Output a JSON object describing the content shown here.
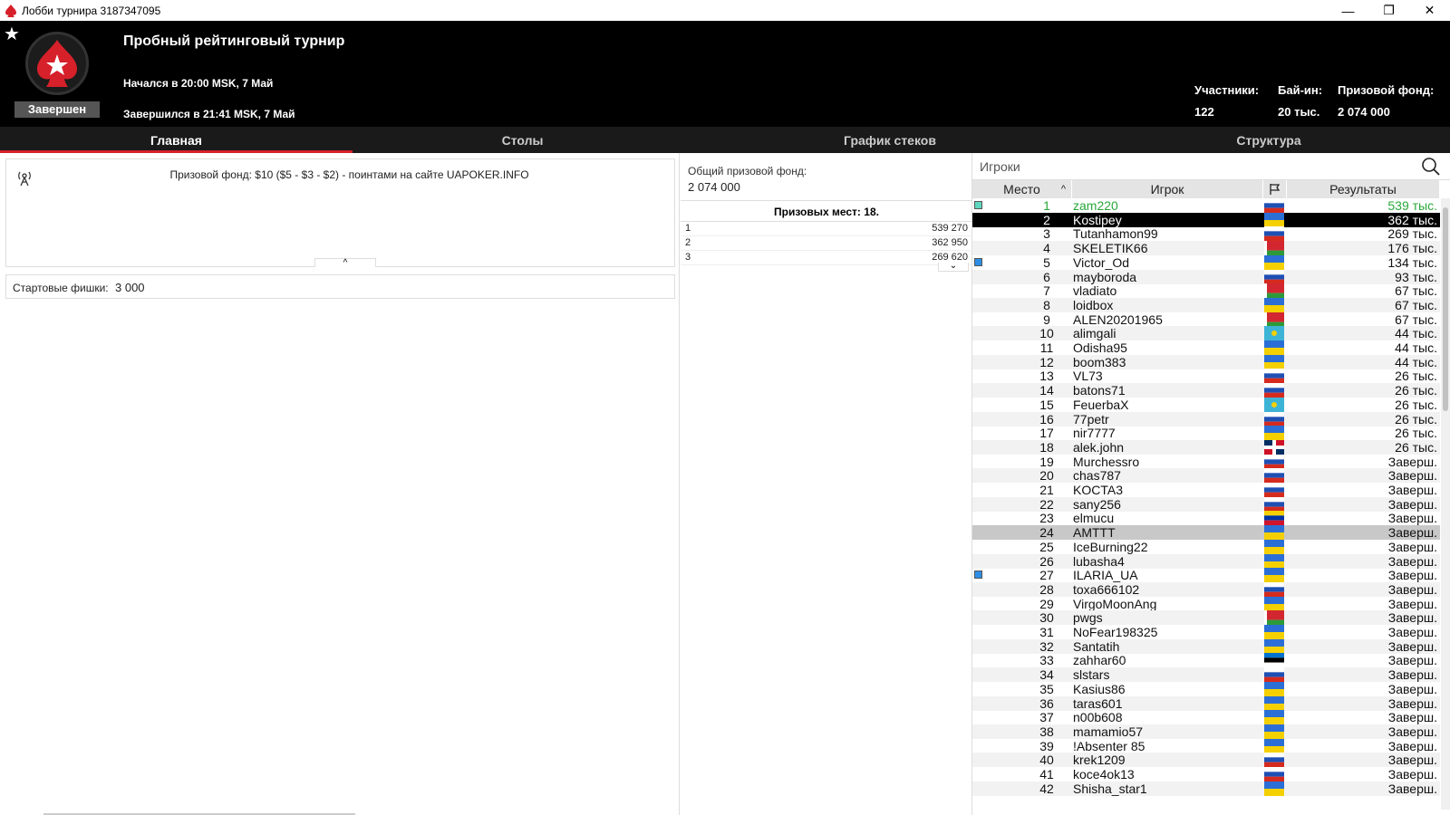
{
  "window": {
    "title": "Лобби турнира 3187347095",
    "minimize": "—",
    "maximize": "❐",
    "close": "✕"
  },
  "header": {
    "status": "Завершен",
    "name": "Пробный рейтинговый турнир",
    "started": "Начался в 20:00 MSK, 7 Май",
    "ended": "Завершился в 21:41 MSK, 7 Май",
    "participants_label": "Участники:",
    "participants_value": "122",
    "buyin_label": "Бай-ин:",
    "buyin_value": "20 тыс.",
    "prizepool_label": "Призовой фонд:",
    "prizepool_value": "2 074 000"
  },
  "tabs": [
    "Главная",
    "Столы",
    "График стеков",
    "Структура"
  ],
  "main": {
    "info_text": "Призовой фонд: $10 ($5 - $3 - $2) - поинтами на сайте UAPOKER.INFO",
    "collapse_glyph": "^",
    "chips_label": "Стартовые фишки:",
    "chips_value": "3 000"
  },
  "prizes": {
    "pool_label": "Общий призовой фонд:",
    "pool_value": "2 074 000",
    "places_label": "Призовых мест: 18.",
    "expand_glyph": "⌄",
    "rows": [
      {
        "place": "1",
        "amount": "539 270"
      },
      {
        "place": "2",
        "amount": "362 950"
      },
      {
        "place": "3",
        "amount": "269 620"
      }
    ]
  },
  "players": {
    "search_placeholder": "Игроки",
    "col_place": "Место",
    "col_player": "Игрок",
    "col_results": "Результаты",
    "colors": {
      "accent": "#d6202a",
      "win": "#2aa83a",
      "mark_teal": "#5fd6c0",
      "mark_blue": "#2d8ee6"
    },
    "rows": [
      {
        "place": "1",
        "nick": "zam220",
        "flag": "ru",
        "result": "539 тыс.",
        "mark": "teal"
      },
      {
        "place": "2",
        "nick": "Kostipey",
        "flag": "ua",
        "result": "362 тыс."
      },
      {
        "place": "3",
        "nick": "Tutanhamon99",
        "flag": "ru",
        "result": "269 тыс."
      },
      {
        "place": "4",
        "nick": "SKELETIK66",
        "flag": "by",
        "result": "176 тыс."
      },
      {
        "place": "5",
        "nick": "Victor_Od",
        "flag": "ua",
        "result": "134 тыс.",
        "mark": "blue"
      },
      {
        "place": "6",
        "nick": "mayboroda",
        "flag": "ru",
        "result": "93 тыс."
      },
      {
        "place": "7",
        "nick": "vladiato",
        "flag": "by",
        "result": "67 тыс."
      },
      {
        "place": "8",
        "nick": "loidbox",
        "flag": "ua",
        "result": "67 тыс."
      },
      {
        "place": "9",
        "nick": "ALEN20201965",
        "flag": "by",
        "result": "67 тыс."
      },
      {
        "place": "10",
        "nick": "alimgali",
        "flag": "kz",
        "result": "44 тыс."
      },
      {
        "place": "11",
        "nick": "Odisha95",
        "flag": "ua",
        "result": "44 тыс."
      },
      {
        "place": "12",
        "nick": "boom383",
        "flag": "ua",
        "result": "44 тыс."
      },
      {
        "place": "13",
        "nick": "VL73",
        "flag": "ru",
        "result": "26 тыс."
      },
      {
        "place": "14",
        "nick": "batons71",
        "flag": "ru",
        "result": "26 тыс."
      },
      {
        "place": "15",
        "nick": "FeuerbaX",
        "flag": "kz",
        "result": "26 тыс."
      },
      {
        "place": "16",
        "nick": "77petr",
        "flag": "ru",
        "result": "26 тыс."
      },
      {
        "place": "17",
        "nick": "nir7777",
        "flag": "ua",
        "result": "26 тыс."
      },
      {
        "place": "18",
        "nick": "alek.john",
        "flag": "do",
        "result": "26 тыс."
      },
      {
        "place": "19",
        "nick": "Murchessro",
        "flag": "ru",
        "result": "Заверш."
      },
      {
        "place": "20",
        "nick": "chas787",
        "flag": "ru",
        "result": "Заверш."
      },
      {
        "place": "21",
        "nick": "KOCTA3",
        "flag": "ru",
        "result": "Заверш."
      },
      {
        "place": "22",
        "nick": "sany256",
        "flag": "ru",
        "result": "Заверш."
      },
      {
        "place": "23",
        "nick": "elmucu",
        "flag": "ve",
        "result": "Заверш."
      },
      {
        "place": "24",
        "nick": "AMTTT",
        "flag": "ua",
        "result": "Заверш."
      },
      {
        "place": "25",
        "nick": "IceBurning22",
        "flag": "ua",
        "result": "Заверш."
      },
      {
        "place": "26",
        "nick": "lubasha4",
        "flag": "ua",
        "result": "Заверш."
      },
      {
        "place": "27",
        "nick": "ILARIA_UA",
        "flag": "ua",
        "result": "Заверш.",
        "mark": "blue"
      },
      {
        "place": "28",
        "nick": "toxa666102",
        "flag": "ru",
        "result": "Заверш."
      },
      {
        "place": "29",
        "nick": "VirgoMoonAng",
        "flag": "ua",
        "result": "Заверш."
      },
      {
        "place": "30",
        "nick": "pwgs",
        "flag": "by",
        "result": "Заверш."
      },
      {
        "place": "31",
        "nick": "NoFear198325",
        "flag": "ua",
        "result": "Заверш."
      },
      {
        "place": "32",
        "nick": "Santatih",
        "flag": "ua",
        "result": "Заверш."
      },
      {
        "place": "33",
        "nick": "zahhar60",
        "flag": "ee",
        "result": "Заверш."
      },
      {
        "place": "34",
        "nick": "slstars",
        "flag": "ru",
        "result": "Заверш."
      },
      {
        "place": "35",
        "nick": "Kasius86",
        "flag": "ua",
        "result": "Заверш."
      },
      {
        "place": "36",
        "nick": "taras601",
        "flag": "ua",
        "result": "Заверш."
      },
      {
        "place": "37",
        "nick": "n00b608",
        "flag": "ua",
        "result": "Заверш."
      },
      {
        "place": "38",
        "nick": "mamamio57",
        "flag": "ua",
        "result": "Заверш."
      },
      {
        "place": "39",
        "nick": "!Absenter 85",
        "flag": "ua",
        "result": "Заверш."
      },
      {
        "place": "40",
        "nick": "krek1209",
        "flag": "ru",
        "result": "Заверш."
      },
      {
        "place": "41",
        "nick": "koce4ok13",
        "flag": "ru",
        "result": "Заверш."
      },
      {
        "place": "42",
        "nick": "Shisha_star1",
        "flag": "ua",
        "result": "Заверш."
      }
    ]
  }
}
